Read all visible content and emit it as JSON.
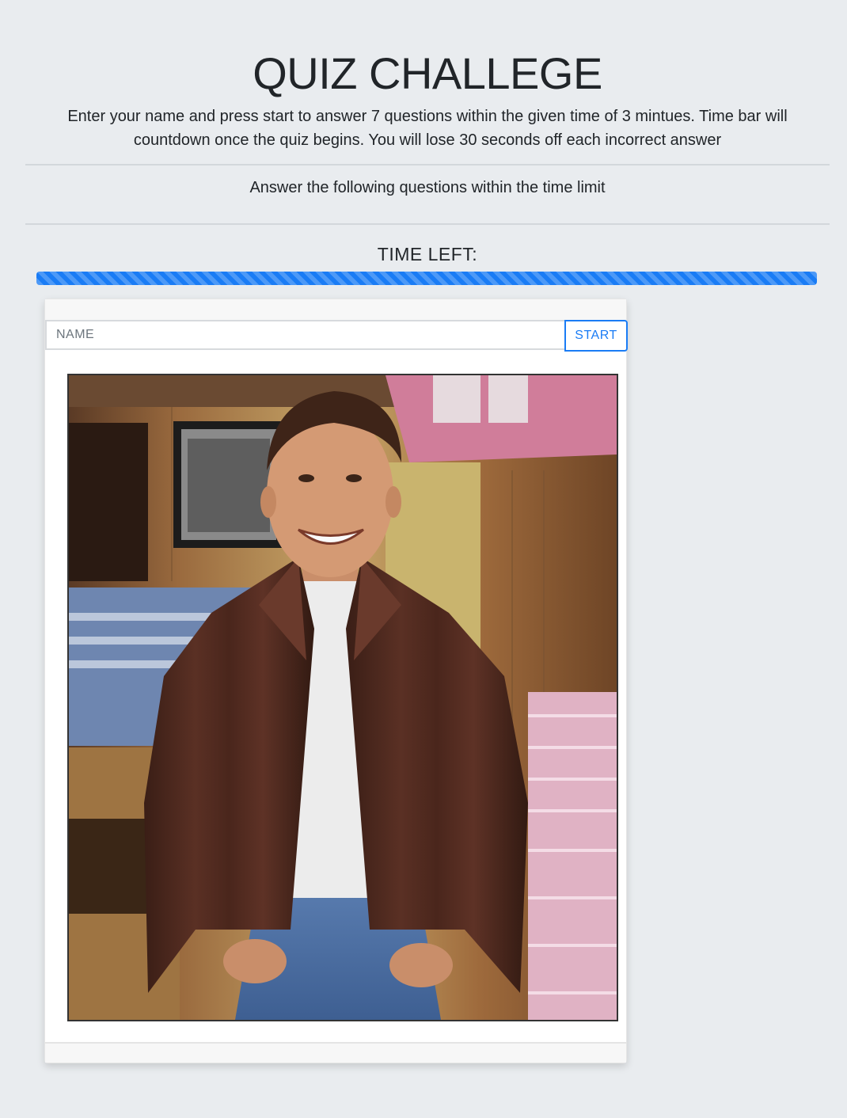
{
  "header": {
    "title": "QUIZ CHALLEGE",
    "lead": "Enter your name and press start to answer 7 questions within the given time of 3 mintues. Time bar will countdown once the quiz begins. You will lose 30 seconds off each incorrect answer"
  },
  "subtitle": "Answer the following questions within the time limit",
  "timer": {
    "label": "TIME LEFT:",
    "progress_percent": 100,
    "bar_color": "#1a7cf5"
  },
  "quiz_card": {
    "name_placeholder": "NAME",
    "name_value": "",
    "start_label": "START",
    "photo_icon": "photo-of-smiling-man-in-brown-leather-jacket"
  },
  "colors": {
    "background": "#e9ecef",
    "accent": "#1a7cf5",
    "text": "#212529"
  }
}
